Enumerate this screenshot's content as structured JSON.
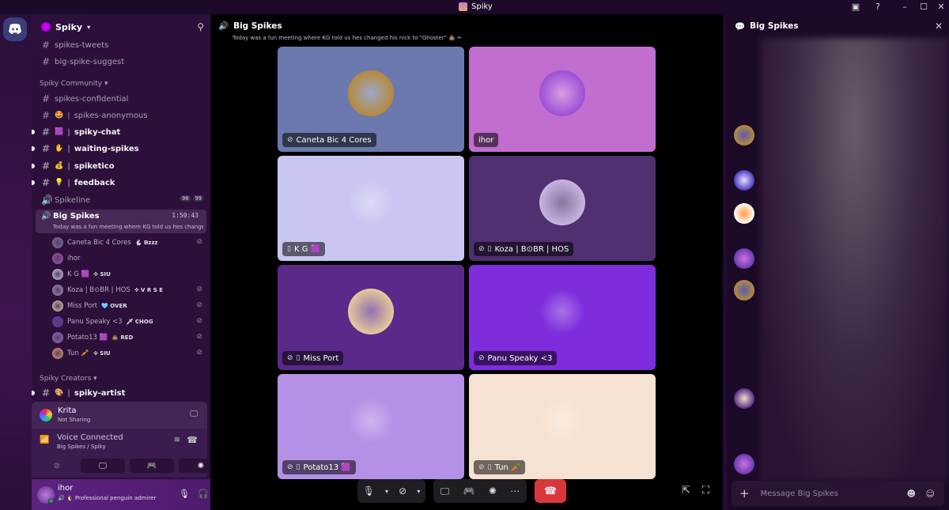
{
  "titlebar": {
    "app_name": "Spiky"
  },
  "server": {
    "name": "Spiky"
  },
  "channels": [
    {
      "name": "spikes-tweets",
      "bold": false
    },
    {
      "name": "big-spike-suggest",
      "bold": false
    }
  ],
  "categories": {
    "community": "Spiky Community",
    "creators": "Spiky Creators"
  },
  "community_channels": [
    {
      "name": "spikes-confidential",
      "emoji": "",
      "bold": false
    },
    {
      "name": "spikes-anonymous",
      "emoji": "🤩",
      "bold": false
    },
    {
      "name": "spiky-chat",
      "emoji": "🟪",
      "bold": true
    },
    {
      "name": "waiting-spikes",
      "emoji": "✋",
      "bold": true
    },
    {
      "name": "spiketico",
      "emoji": "💰",
      "bold": true
    },
    {
      "name": "feedback",
      "emoji": "💡",
      "bold": true
    }
  ],
  "spikeline": {
    "name": "Spikeline",
    "badges": [
      "00",
      "99"
    ]
  },
  "active_voice": {
    "name": "Big Spikes",
    "timer": "1:50:43",
    "topic": "Today was a fun meeting where KG told us hes changed..."
  },
  "members": [
    {
      "name": "Caneta Bic 4 Cores",
      "tag": "🐇 Bzzz",
      "muted": true,
      "color": "#8a6fb0"
    },
    {
      "name": "ihor",
      "tag": "",
      "muted": false,
      "color": "#b04fb8"
    },
    {
      "name": "K G 🟪",
      "tag": "✜ SIU",
      "muted": false,
      "color": "#d9d4ee"
    },
    {
      "name": "Koza | B⊙BR | HOS",
      "tag": "✜ V R S E",
      "muted": true,
      "color": "#a890c0"
    },
    {
      "name": "Miss Port",
      "tag": "🩵 OVER",
      "muted": true,
      "color": "#e8d2a4"
    },
    {
      "name": "Panu Speaky <3",
      "tag": "🗡 CHOG",
      "muted": true,
      "color": "#6a2ec0"
    },
    {
      "name": "Potato13 🟪",
      "tag": "💩 RED",
      "muted": true,
      "color": "#9b6bd0"
    },
    {
      "name": "Tun 🥕",
      "tag": "✜ SIU",
      "muted": true,
      "color": "#f0a070"
    }
  ],
  "artist_channel": {
    "name": "spiky-artist",
    "emoji": "🎨"
  },
  "activity": {
    "title": "Krita",
    "status": "Not Sharing"
  },
  "voice_status": {
    "title": "Voice Connected",
    "sub": "Big Spikes / Spiky"
  },
  "user": {
    "name": "ihor",
    "status": "Professional penguin admirer"
  },
  "stage": {
    "title": "Big Spikes",
    "topic": "Today was a fun meeting where KG told us hes changed his nick to \"Ghoster\" 💩 ✏",
    "tiles": [
      {
        "label": "Caneta Bic 4 Cores",
        "bg": "#6b79ae",
        "av": "#b58a3c",
        "mute": true,
        "phone": false
      },
      {
        "label": "ihor",
        "bg": "#c26dd0",
        "av": "#9c4fd8",
        "mute": false,
        "phone": false
      },
      {
        "label": "K G 🟪",
        "bg": "#c9c7f1",
        "av": "#c9c7f1",
        "mute": false,
        "phone": true
      },
      {
        "label": "Koza | B⊙BR | HOS",
        "bg": "#4f3070",
        "av": "#c8b4e0",
        "mute": true,
        "phone": true
      },
      {
        "label": "Miss Port",
        "bg": "#5a2a8a",
        "av": "#e6c89a",
        "mute": true,
        "phone": true
      },
      {
        "label": "Panu Speaky <3",
        "bg": "#7e2cdc",
        "av": "#7e2cdc",
        "mute": true,
        "phone": false
      },
      {
        "label": "Potato13 🟪",
        "bg": "#b491e6",
        "av": "#b491e6",
        "mute": true,
        "phone": true
      },
      {
        "label": "Tun 🥕",
        "bg": "#f6e2d2",
        "av": "#f6e2d2",
        "mute": true,
        "phone": true
      }
    ]
  },
  "chat": {
    "title": "Big Spikes",
    "placeholder": "Message Big Spikes"
  },
  "icons": {
    "discord": "discord-icon",
    "hash": "hash-icon",
    "speaker": "speaker-icon",
    "mic": "mic-icon",
    "headphones": "headphones-icon",
    "gear": "gear-icon",
    "end_call": "end-call-icon"
  }
}
